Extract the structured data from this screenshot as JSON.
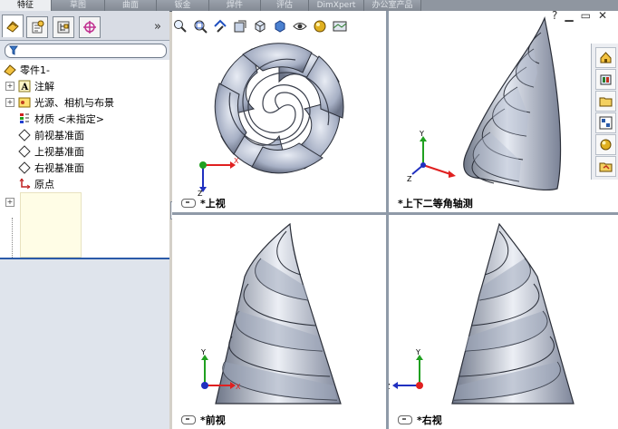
{
  "command_tabs": [
    "特征",
    "草图",
    "曲面",
    "钣金",
    "焊件",
    "评估",
    "DimXpert",
    "办公室产品"
  ],
  "panel_tabs": {
    "icons": [
      "feature-manager-icon",
      "property-manager-icon",
      "configuration-manager-icon",
      "dim-xpert-manager-icon"
    ],
    "more": "»"
  },
  "tree": {
    "root": "零件1-",
    "items": [
      {
        "label": "注解",
        "icon": "annotations-icon",
        "expandable": true
      },
      {
        "label": "光源、相机与布景",
        "icon": "lights-cameras-icon",
        "expandable": true
      },
      {
        "label": "材质 <未指定>",
        "icon": "material-icon",
        "expandable": false
      },
      {
        "label": "前视基准面",
        "icon": "plane-icon",
        "expandable": false
      },
      {
        "label": "上视基准面",
        "icon": "plane-icon",
        "expandable": false
      },
      {
        "label": "右视基准面",
        "icon": "plane-icon",
        "expandable": false
      },
      {
        "label": "原点",
        "icon": "origin-icon",
        "expandable": false
      }
    ]
  },
  "viewports": {
    "top_left": "*上视",
    "top_right": "*上下二等角轴测",
    "bottom_left": "*前视",
    "bottom_right": "*右视"
  },
  "triad_labels": {
    "x": "X",
    "y": "Y",
    "z": "Z"
  },
  "window_controls": [
    "?",
    "▁",
    "▭",
    "✕"
  ],
  "colors": {
    "accent_blue": "#2a5aa8",
    "axis_x": "#e02020",
    "axis_y": "#20a020",
    "axis_z": "#2030c0"
  }
}
